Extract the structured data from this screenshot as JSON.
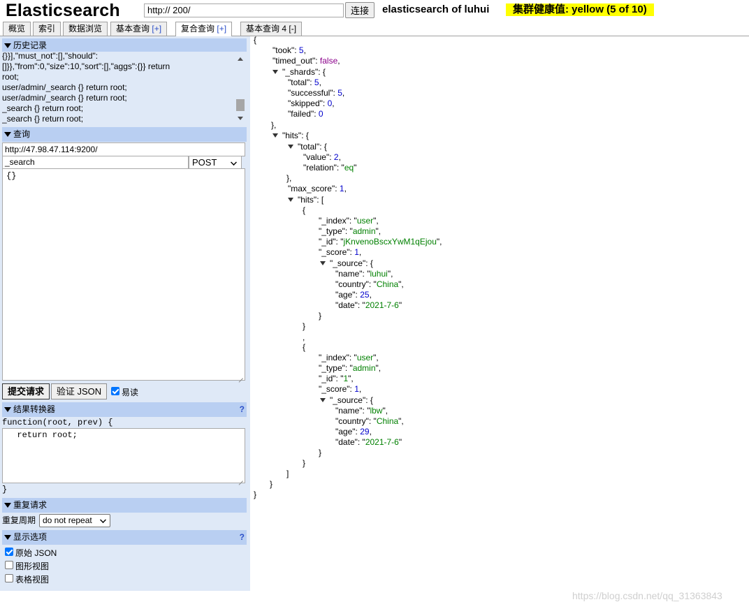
{
  "header": {
    "app_title": "Elasticsearch",
    "server_url": "http://        200/",
    "connect_label": "连接",
    "cluster_name": "elasticsearch of luhui",
    "health": "集群健康值: yellow (5 of 10)",
    "health_color": "#ffff00"
  },
  "tabs": [
    {
      "label": "概览"
    },
    {
      "label": "索引"
    },
    {
      "label": "数据浏览"
    },
    {
      "label": "基本查询",
      "plus": "[+]"
    },
    {
      "label": "复合查询",
      "plus": "[+]",
      "active": true
    },
    {
      "label": "基本查询 4",
      "plus": "[-]"
    }
  ],
  "history": {
    "title": "历史记录",
    "text": "{}}],\"must_not\":[],\"should\":\n[]}},\"from\":0,\"size\":10,\"sort\":[],\"aggs\":{}} return\nroot;\nuser/admin/_search {} return root;\nuser/admin/_search {} return root;\n_search {} return root;\n_search {} return root;"
  },
  "query": {
    "title": "查询",
    "url": "http://47.98.47.114:9200/",
    "path": "_search",
    "method": "POST",
    "body": "{}",
    "submit_label": "提交请求",
    "validate_label": "验证 JSON",
    "easy_read_label": "易读",
    "easy_read_checked": true
  },
  "transformer": {
    "title": "结果转换器",
    "help": "?",
    "signature": "function(root, prev) {",
    "body": "  return root;",
    "close": "}"
  },
  "repeat": {
    "title": "重复请求",
    "period_label": "重复周期",
    "period_value": "do not repeat"
  },
  "display": {
    "title": "显示选项",
    "help": "?",
    "options": [
      {
        "label": "原始 JSON",
        "checked": true
      },
      {
        "label": "图形视图",
        "checked": false
      },
      {
        "label": "表格视图",
        "checked": false
      }
    ]
  },
  "result": {
    "took": 5,
    "timed_out": false,
    "shards": {
      "total": 5,
      "successful": 5,
      "skipped": 0,
      "failed": 0
    },
    "hits_total": {
      "value": 2,
      "relation": "eq"
    },
    "max_score": 1,
    "hits": [
      {
        "index": "user",
        "type": "admin",
        "id": "jKnvenoBscxYwM1qEjou",
        "score": 1,
        "source": {
          "name": "luhui",
          "country": "China",
          "age": 25,
          "date": "2021-7-6"
        }
      },
      {
        "index": "user",
        "type": "admin",
        "id": "1",
        "score": 1,
        "source": {
          "name": "lbw",
          "country": "China",
          "age": 29,
          "date": "2021-7-6"
        }
      }
    ]
  },
  "watermark": "https://blog.csdn.net/qq_31363843"
}
